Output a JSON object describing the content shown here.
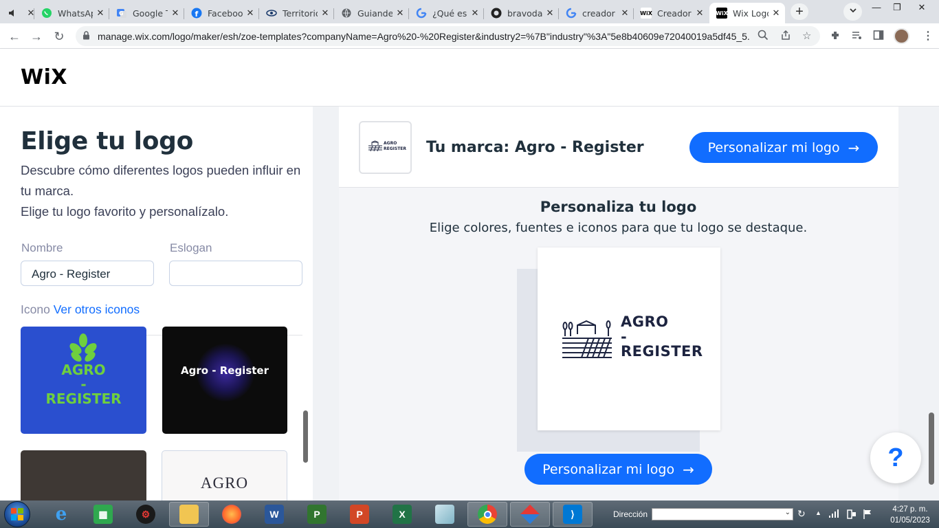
{
  "browser": {
    "tabs": [
      {
        "label": "",
        "favicon": "speaker-icon"
      },
      {
        "label": "WhatsApp",
        "favicon": "whatsapp-icon"
      },
      {
        "label": "Google T",
        "favicon": "google-translate-icon"
      },
      {
        "label": "Facebook",
        "favicon": "facebook-icon"
      },
      {
        "label": "Territorio",
        "favicon": "eye-icon"
      },
      {
        "label": "Guiande",
        "favicon": "globe-icon"
      },
      {
        "label": "¿Qué es",
        "favicon": "google-icon"
      },
      {
        "label": "bravoda",
        "favicon": "github-icon"
      },
      {
        "label": "creador",
        "favicon": "google-icon"
      },
      {
        "label": "Creador",
        "favicon": "wix-icon"
      },
      {
        "label": "Wix Logo",
        "favicon": "wix-icon"
      }
    ],
    "url": "manage.wix.com/logo/maker/esh/zoe-templates?companyName=Agro%20-%20Register&industry2=%7B\"industry\"%3A\"5e8b40609e72040019a5df45_5..."
  },
  "header": {
    "logo": "WiX"
  },
  "left": {
    "title": "Elige tu logo",
    "description_line1": "Descubre cómo diferentes logos pueden influir en tu marca.",
    "description_line2": "Elige tu logo favorito y personalízalo.",
    "name_label": "Nombre",
    "name_value": "Agro - Register",
    "slogan_label": "Eslogan",
    "slogan_value": "",
    "icon_label": "Icono",
    "icon_link": "Ver otros iconos",
    "cards": [
      {
        "line1": "AGRO",
        "line2": "-",
        "line3": "REGISTER"
      },
      {
        "text": "Agro - Register"
      },
      {
        "text": ""
      },
      {
        "text": "AGRO"
      }
    ]
  },
  "right": {
    "thumb_line1": "AGRO",
    "thumb_line2": "REGISTER",
    "brand_label": "Tu marca: Agro - Register",
    "customize_button": "Personalizar mi logo",
    "customize_title": "Personaliza tu logo",
    "customize_subtitle": "Elige colores, fuentes e iconos para que tu logo se destaque.",
    "logo_line1": "AGRO",
    "logo_line2": "-",
    "logo_line3": "REGISTER",
    "help_symbol": "?"
  },
  "taskbar": {
    "address_label": "Dirección",
    "time": "4:27 p. m.",
    "date": "01/05/2023"
  },
  "colors": {
    "accent": "#116dff",
    "card_blue": "#2a4fcf",
    "card_green": "#6fcf3e",
    "card_black": "#0c0c0c",
    "card_brown": "#3e3834",
    "logo_navy": "#1d2440"
  }
}
